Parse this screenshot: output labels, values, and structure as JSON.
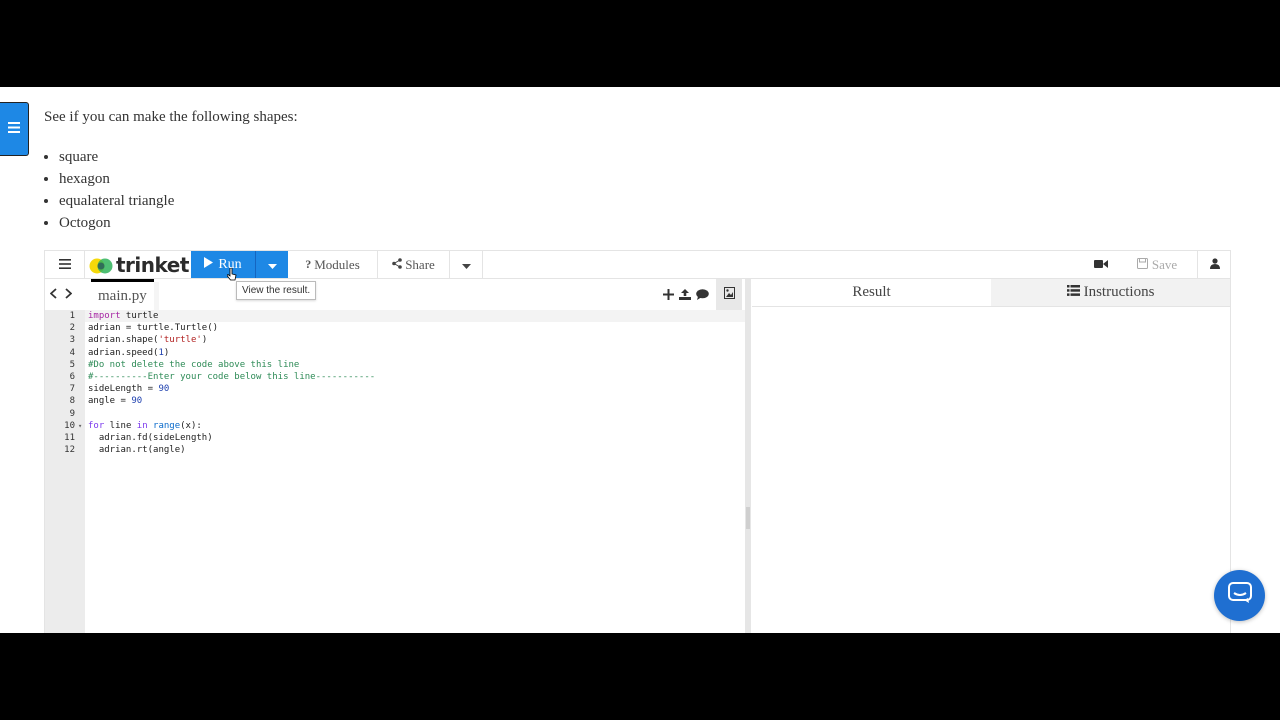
{
  "page": {
    "intro": "See if you can make the following shapes:",
    "shapes": [
      "square",
      "hexagon",
      "equalateral triangle",
      "Octogon"
    ]
  },
  "toolbar": {
    "logo_text": "trinket",
    "run_label": "Run",
    "modules_label": "Modules",
    "share_label": "Share",
    "save_label": "Save",
    "run_tooltip": "View the result."
  },
  "editor": {
    "file_tab": "main.py",
    "line_numbers": [
      "1",
      "2",
      "3",
      "4",
      "5",
      "6",
      "7",
      "8",
      "9",
      "10",
      "11",
      "12"
    ]
  },
  "right_panel": {
    "tabs": [
      "Result",
      "Instructions"
    ]
  },
  "colors": {
    "accent": "#1e88e5",
    "chat": "#1f6fd1"
  }
}
